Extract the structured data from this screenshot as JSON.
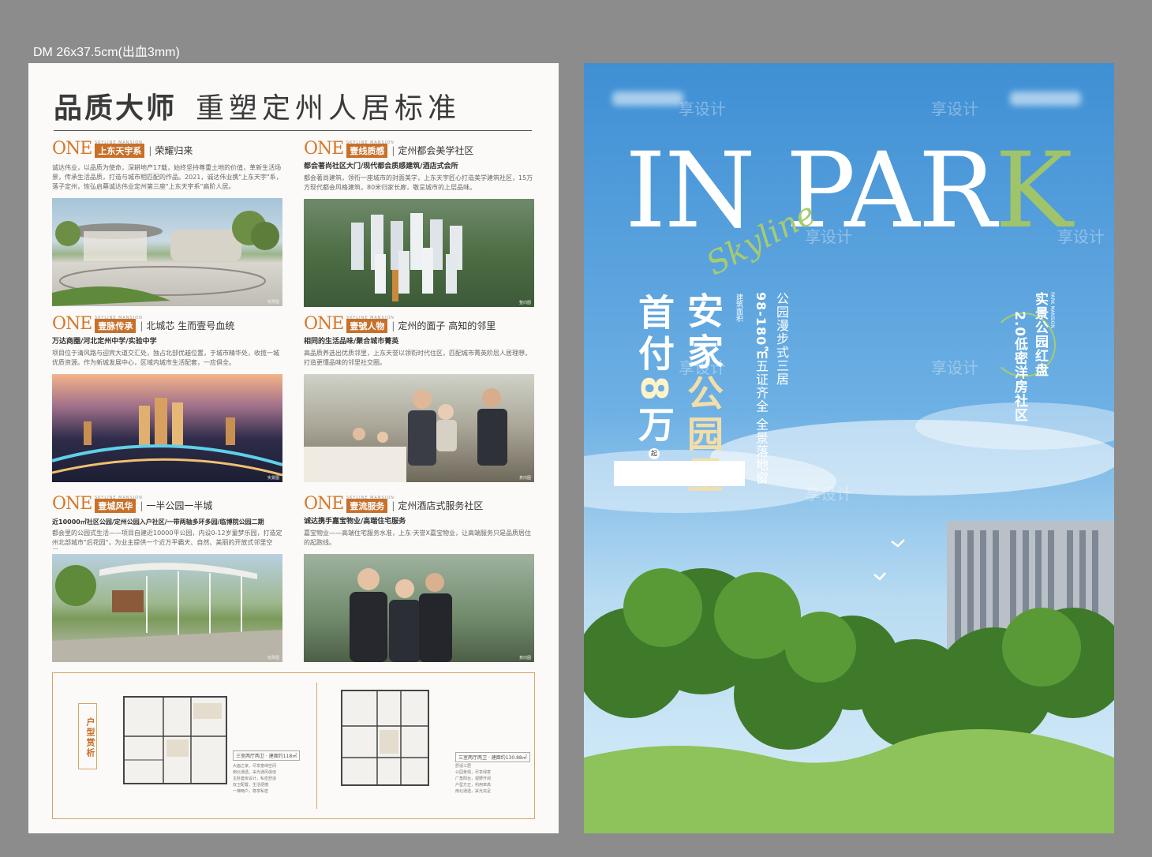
{
  "spec_label": "DM 26x37.5cm(出血3mm)",
  "left_page": {
    "headline_a": "品质大师",
    "headline_b": "重塑定州人居标准",
    "features": [
      {
        "one": "ONE",
        "tag": "上东天宇系",
        "sub": "荣耀归来",
        "eng": "SKYLINE MANSION",
        "bold": "",
        "body": "诚达伟业，以品质为使命，深耕地产17载，始终坚持尊重土地的价值，革新生活场景，传承生活品质，打造与城市相匹配的作品。2021，诚达伟业携\"上东天宇\"系，落子定州，恢弘启幕诚达伟业定州第三座\"上东天宇系\"高阶人居。",
        "cap": "效果图"
      },
      {
        "one": "ONE",
        "tag": "壹线质感",
        "sub": "定州都会美学社区",
        "eng": "SKYLINE MANSION",
        "bold": "都会著尚社区大门/现代都会质感建筑/酒店式会所",
        "body": "都会著尚建筑，领衔一座城市的封面美学，上东天宇匠心打造美学建筑社区，15万方现代都会风格建筑，80米归家长廊，敬呈城市的上层品味。",
        "cap": "整向图"
      },
      {
        "one": "ONE",
        "tag": "壹脉传承",
        "sub": "北城芯 生而壹号血统",
        "eng": "SKYLINE MANSION",
        "bold": "万达商圈/河北定州中学/实验中学",
        "body": "项目位于清风路与迎宾大道交汇处，独占北部优越位置，于城市精华处，收揽一城优质资源。作为新城发展中心，区域内城市生活配套，一应俱全。",
        "cap": "实景图"
      },
      {
        "one": "ONE",
        "tag": "壹號人物",
        "sub": "定州的面子 高知的邻里",
        "eng": "SKYLINE MANSION",
        "bold": "相同的生活品味/聚合城市菁英",
        "body": "高品质养选出优质邻里，上东天誉以领衔时代住区，匹配城市菁英阶层人居理想，打造更懂品味的邻里社交圈。",
        "cap": "意向图"
      },
      {
        "one": "ONE",
        "tag": "壹城风华",
        "sub": "一半公园一半城",
        "eng": "SKYLINE MANSION",
        "bold": "近10000㎡社区公园/定州公园入户社区/一带两轴多环多园/临博院公园二期",
        "body": "都会里的公园式生活——项目自建近10000平公园，内设0-12岁童梦乐园，打造定州北部城市\"后花园\"，为业主提供一个近万平霸天、自然、美丽的开放式邻里空间。",
        "cap": "效果图"
      },
      {
        "one": "ONE",
        "tag": "壹流服务",
        "sub": "定州酒店式服务社区",
        "eng": "SKYLINE MANSION",
        "bold": "诚达携手嘉宝物业/高端住宅服务",
        "body": "嘉宝物业——高端住宅服务水准，上东·天誉X嘉宝物业，让高端服务只是品质居住的起跑线。",
        "cap": "意向图"
      }
    ],
    "plans": {
      "title": "户型赏析",
      "plan_a_tag": "三室两厅两卫 · 建面约118㎡",
      "plan_a_text": "大面之家，尽享宽绰空间\n南北通透，采光通风俱佳\n主卧套房设计，私密舒适\n双卫配置，生活便捷\n一梯两户，尊享私密",
      "plan_b_tag": "三室两厅两卫 · 建面约130.88㎡",
      "plan_b_text": "舒适三居\n公园景观，尽享绿意\n广角阳台，视野开阔\n户型方正，利用率高\n南北通透，采光充足"
    }
  },
  "right_page": {
    "title_main": "IN PAR",
    "title_k": "K",
    "script": "Skyline",
    "shoufu_a": "首付",
    "shoufu_num": "8",
    "shoufu_b": "万",
    "qi": "起",
    "anjia_a": "安家",
    "anjia_b": "公园里",
    "jianmian": "建筑面积",
    "col1": "公园漫步式三居",
    "col2_num": "98-180㎡",
    "col2_rest": "五证齐全 全景落地窗",
    "r_small": "PARK MANSION",
    "r1": "实景公园红盘",
    "r2": "2.0低密洋房社区",
    "watermark": "享设计"
  },
  "colors": {
    "accent": "#c8702a",
    "green": "#9fc46a",
    "sky": "#4d9ad6"
  },
  "icons": [
    "bird-icon"
  ]
}
